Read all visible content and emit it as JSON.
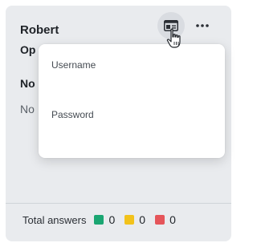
{
  "card": {
    "name": "Robert",
    "subtitle": "Op",
    "no_label_1": "No",
    "no_label_2": "No"
  },
  "popover": {
    "username_label": "Username",
    "password_label": "Password"
  },
  "footer": {
    "total_answers_label": "Total answers",
    "stats": [
      {
        "color": "#1aa672",
        "count": "0"
      },
      {
        "color": "#f2c21b",
        "count": "0"
      },
      {
        "color": "#e5555a",
        "count": "0"
      }
    ]
  },
  "icons": {
    "id_card": "id-card-icon",
    "more": "more-horizontal-icon",
    "cursor": "hand-pointer-icon"
  }
}
